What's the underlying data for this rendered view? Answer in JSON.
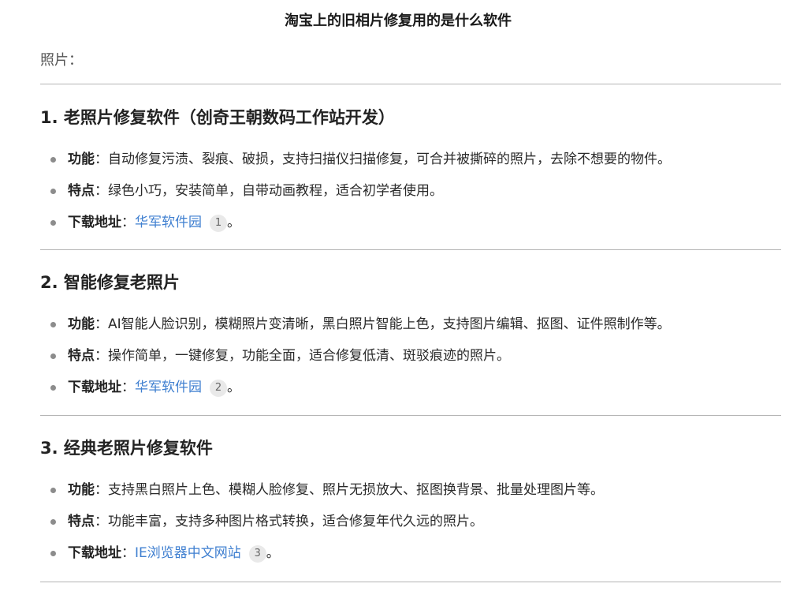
{
  "title": "淘宝上的旧相片修复用的是什么软件",
  "intro": "照片：",
  "label_sep": "：",
  "sections": [
    {
      "heading": "1. 老照片修复软件（创奇王朝数码工作站开发）",
      "items": [
        {
          "label": "功能",
          "text": "自动修复污渍、裂痕、破损，支持扫描仪扫描修复，可合并被撕碎的照片，去除不想要的物件。"
        },
        {
          "label": "特点",
          "text": "绿色小巧，安装简单，自带动画教程，适合初学者使用。"
        },
        {
          "label": "下载地址",
          "link": "华军软件园",
          "cite": "1",
          "end": "。"
        }
      ]
    },
    {
      "heading": "2. 智能修复老照片",
      "items": [
        {
          "label": "功能",
          "text": "AI智能人脸识别，模糊照片变清晰，黑白照片智能上色，支持图片编辑、抠图、证件照制作等。"
        },
        {
          "label": "特点",
          "text": "操作简单，一键修复，功能全面，适合修复低清、斑驳痕迹的照片。"
        },
        {
          "label": "下载地址",
          "link": "华军软件园",
          "cite": "2",
          "end": "。"
        }
      ]
    },
    {
      "heading": "3. 经典老照片修复软件",
      "items": [
        {
          "label": "功能",
          "text": "支持黑白照片上色、模糊人脸修复、照片无损放大、抠图换背景、批量处理图片等。"
        },
        {
          "label": "特点",
          "text": "功能丰富，支持多种图片格式转换，适合修复年代久远的照片。"
        },
        {
          "label": "下载地址",
          "link": "IE浏览器中文网站",
          "cite": "3",
          "end": "。"
        }
      ]
    }
  ]
}
